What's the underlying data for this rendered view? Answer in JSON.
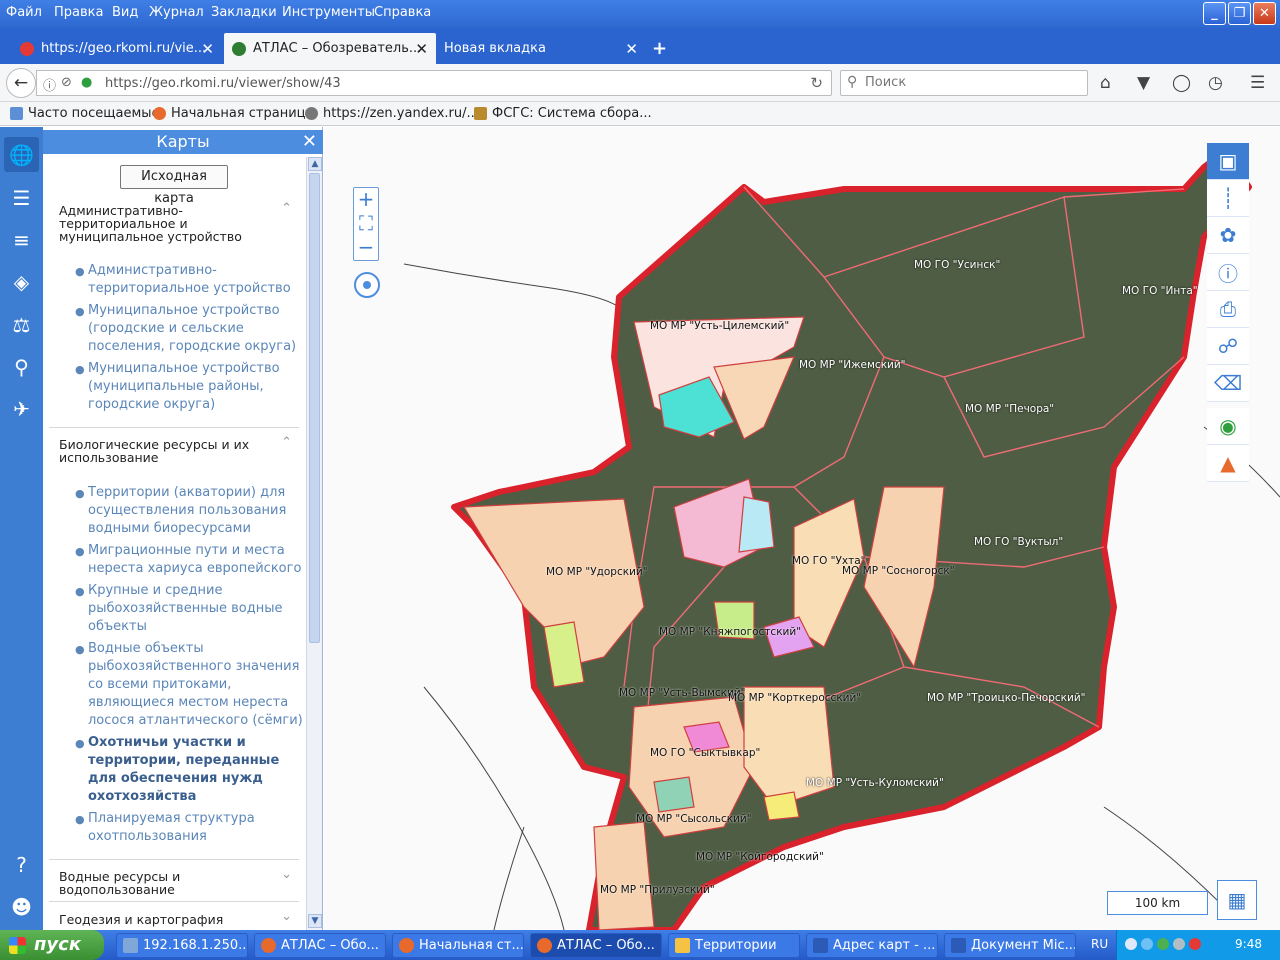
{
  "menubar": {
    "items": [
      "Файл",
      "Правка",
      "Вид",
      "Журнал",
      "Закладки",
      "Инструменты",
      "Справка"
    ]
  },
  "tabs": [
    {
      "title": "https://geo.rkomi.ru/vie...",
      "favicon_color": "#e53935"
    },
    {
      "title": "АТЛАС – Обозреватель...",
      "favicon_color": "#2e7d32",
      "active": true
    },
    {
      "title": "Новая вкладка",
      "favicon_color": ""
    }
  ],
  "newtab_label": "+",
  "navbar": {
    "url": "https://geo.rkomi.ru/viewer/show/43",
    "search_placeholder": "Поиск"
  },
  "bookmarks": [
    {
      "label": "Часто посещаемые",
      "color": "#5c8fd6"
    },
    {
      "label": "Начальная страница",
      "color": "#e8692c"
    },
    {
      "label": "https://zen.yandex.ru/...",
      "color": "#777777"
    },
    {
      "label": "ФСГС: Система сбора...",
      "color": "#b98a2e"
    }
  ],
  "panel": {
    "title": "Карты",
    "reset_button": "Исходная карта",
    "sections": [
      {
        "title": "Административно-территориальное и муниципальное устройство",
        "expanded": true,
        "items": [
          {
            "label": "Административно-территориальное устройство",
            "selected": false
          },
          {
            "label": "Муниципальное устройство (городские и сельские поселения, городские округа)",
            "selected": false
          },
          {
            "label": "Муниципальное устройство (муниципальные районы, городские округа)",
            "selected": false
          }
        ]
      },
      {
        "title": "Биологические ресурсы и их использование",
        "expanded": true,
        "items": [
          {
            "label": "Территории (акватории) для осуществления пользования водными биоресурсами",
            "selected": false
          },
          {
            "label": "Миграционные пути и места нереста хариуса европейского",
            "selected": false
          },
          {
            "label": "Крупные и средние рыбохозяйственные водные объекты",
            "selected": false
          },
          {
            "label": "Водные объекты рыбохозяйственного значения со всеми притоками, являющиеся местом нереста лосося атлантического (сёмги)",
            "selected": false
          },
          {
            "label": "Охотничьи участки и территории, переданные для обеспечения нужд охотхозяйства",
            "selected": true
          },
          {
            "label": "Планируемая структура охотпользования",
            "selected": false
          }
        ]
      },
      {
        "title": "Водные ресурсы и водопользование",
        "expanded": false,
        "items": []
      },
      {
        "title": "Геодезия и картография",
        "expanded": false,
        "items": []
      }
    ]
  },
  "map": {
    "scale_label": "100 km",
    "labels": [
      "МО ГО \"Усинск\"",
      "МО ГО \"Инта\"",
      "МО МР \"Усть-Цилемский\"",
      "МО МР \"Ижемский\"",
      "МО МР \"Печора\"",
      "МО ГО \"Вуктыл\"",
      "МО МР \"Удорский\"",
      "МО ГО \"Ухта\"",
      "МО МР \"Сосногорск\"",
      "МО МР \"Княжпогостский\"",
      "МО МР \"Троицко-Печорский\"",
      "МО МР \"Усть-Вымский\"",
      "МО МР \"Корткеросский\"",
      "МО ГО \"Сыктывкар\"",
      "МО МР \"Усть-Куломский\"",
      "МО МР \"Сысольский\"",
      "МО МР \"Койгородский\"",
      "МО МР \"Прилузский\""
    ],
    "tools": [
      "toolbox-icon",
      "ruler-icon",
      "pin-icon",
      "info-icon",
      "print-icon",
      "share-icon",
      "eraser-icon",
      "money-bag-icon",
      "fire-icon"
    ]
  },
  "taskbar": {
    "start_label": "пуск",
    "tasks": [
      {
        "label": "192.168.1.250...",
        "color": "#7fa8d8",
        "active": false
      },
      {
        "label": "АТЛАС – Обо...",
        "color": "#e8692c",
        "active": false
      },
      {
        "label": "Начальная ст...",
        "color": "#e8692c",
        "active": false
      },
      {
        "label": "АТЛАС – Обо...",
        "color": "#e8692c",
        "active": true
      },
      {
        "label": "Территории",
        "color": "#f5c243",
        "active": false
      },
      {
        "label": "Адрес карт - ...",
        "color": "#2b5bb7",
        "active": false
      },
      {
        "label": "Документ Mic...",
        "color": "#2b5bb7",
        "active": false
      }
    ],
    "lang": "RU",
    "clock": "9:48"
  }
}
